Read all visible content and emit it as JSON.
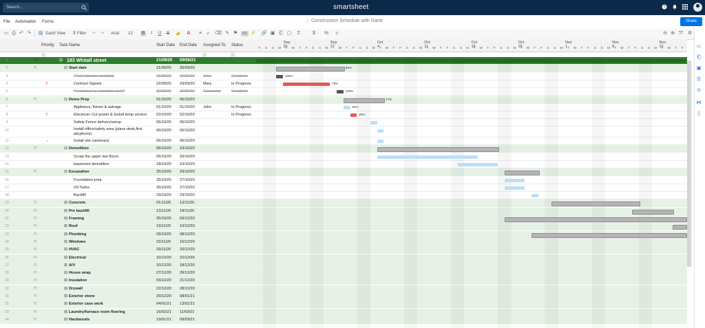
{
  "topbar": {
    "search_placeholder": "Search...",
    "brand": "smartsheet",
    "icons": [
      "help-icon",
      "bell-icon",
      "apps-grid-icon",
      "avatar"
    ]
  },
  "menu": {
    "items": [
      "File",
      "Automation",
      "Forms"
    ],
    "doc_title": "Construction Schedule with Gantt",
    "share_label": "Share"
  },
  "toolbar": {
    "view_label": "Gantt View",
    "filter_label": "Filter",
    "font_label": "Arial",
    "size_label": "12",
    "bold": "B",
    "italic": "I",
    "underline": "U",
    "strike": "S",
    "align": "≡",
    "sum": "Σ",
    "dollar": "$",
    "percent": "%",
    "decimal": ".0",
    "rs_badge": "RS"
  },
  "columns": {
    "priority": "Priority",
    "task": "Task Name",
    "start": "Start Date",
    "end": "End Date",
    "assigned": "Assigned To",
    "status": "Status"
  },
  "gantt": {
    "weeks": [
      "Sep 20",
      "Sep 27",
      "Oct 4",
      "Oct 11",
      "Oct 18",
      "Oct 25",
      "Nov 1",
      "Nov 8",
      "Nov 15"
    ],
    "day_letters": [
      "F",
      "S",
      "S",
      "M",
      "T",
      "W",
      "T",
      "F",
      "S",
      "S",
      "M",
      "T",
      "W",
      "T",
      "F",
      "S",
      "S",
      "M",
      "T",
      "W",
      "T",
      "F",
      "S",
      "S",
      "M",
      "T",
      "W",
      "T",
      "F",
      "S",
      "S",
      "M",
      "T",
      "W",
      "T",
      "F",
      "S",
      "S",
      "M",
      "T",
      "W",
      "T",
      "F",
      "S",
      "S",
      "M",
      "T",
      "W",
      "T",
      "F",
      "S",
      "S",
      "M",
      "T",
      "W",
      "T",
      "F",
      "S",
      "S",
      "M",
      "T",
      "W",
      "T",
      "F"
    ]
  },
  "rows": [
    {
      "num": "1",
      "name": "183 Whitall street",
      "start": "21/09/20",
      "end": "09/06/21",
      "assigned": "",
      "status": "",
      "level": 0,
      "type": "root"
    },
    {
      "num": "2",
      "name": "Start date",
      "start": "21/09/20",
      "end": "30/09/20",
      "assigned": "",
      "status": "",
      "level": 1,
      "type": "parent"
    },
    {
      "num": "3",
      "name": "Final estimate complete",
      "start": "21/09/20",
      "end": "21/09/20",
      "assigned": "John",
      "status": "Complete",
      "level": 2,
      "type": "done"
    },
    {
      "num": "4",
      "name": "Contract Signed",
      "start": "22/09/20",
      "end": "29/09/20",
      "assigned": "Mary",
      "status": "In Progress",
      "level": 2,
      "type": "task",
      "flag": "!"
    },
    {
      "num": "5",
      "name": "Permission to schedule work?",
      "start": "30/09/20",
      "end": "30/09/20",
      "assigned": "Contractor",
      "status": "Complete",
      "level": 2,
      "type": "done"
    },
    {
      "num": "6",
      "name": "Demo Prep",
      "start": "01/10/20",
      "end": "06/10/20",
      "assigned": "",
      "status": "",
      "level": 1,
      "type": "parent"
    },
    {
      "num": "7",
      "name": "Appliance, fixture & salvage",
      "start": "01/10/20",
      "end": "01/10/20",
      "assigned": "John",
      "status": "In Progress",
      "level": 2,
      "type": "task"
    },
    {
      "num": "8",
      "name": "Electrical- Cut power & Install temp service",
      "start": "02/10/20",
      "end": "02/10/20",
      "assigned": "",
      "status": "In Progress",
      "level": 2,
      "type": "task",
      "flag": "!"
    },
    {
      "num": "9",
      "name": "Safety Fence delivery/setup",
      "start": "05/10/20",
      "end": "05/10/20",
      "assigned": "",
      "status": "",
      "level": 2,
      "type": "task"
    },
    {
      "num": "10",
      "name": "Install office/safety area (plans desk,first aid,phone)",
      "start": "06/10/20",
      "end": "06/10/20",
      "assigned": "",
      "status": "",
      "level": 2,
      "type": "task",
      "tall": true
    },
    {
      "num": "11",
      "name": "Install site camera(s)",
      "start": "06/10/20",
      "end": "06/10/20",
      "assigned": "",
      "status": "",
      "level": 2,
      "type": "task",
      "flag": "↓"
    },
    {
      "num": "12",
      "name": "Demolition",
      "start": "06/10/20",
      "end": "23/10/20",
      "assigned": "",
      "status": "",
      "level": 1,
      "type": "parent"
    },
    {
      "num": "13",
      "name": "Scrap the upper two floors",
      "start": "06/10/20",
      "end": "20/10/20",
      "assigned": "",
      "status": "",
      "level": 2,
      "type": "task"
    },
    {
      "num": "14",
      "name": "basement demolition",
      "start": "18/10/20",
      "end": "23/10/20",
      "assigned": "",
      "status": "",
      "level": 2,
      "type": "task"
    },
    {
      "num": "15",
      "name": "Excavation",
      "start": "25/10/20",
      "end": "29/10/20",
      "assigned": "",
      "status": "",
      "level": 1,
      "type": "parent"
    },
    {
      "num": "16",
      "name": "Foundation prep",
      "start": "25/10/20",
      "end": "27/10/20",
      "assigned": "",
      "status": "",
      "level": 2,
      "type": "task"
    },
    {
      "num": "17",
      "name": "Oil Tanks",
      "start": "25/10/20",
      "end": "27/10/20",
      "assigned": "",
      "status": "",
      "level": 2,
      "type": "task"
    },
    {
      "num": "18",
      "name": "Backfill",
      "start": "29/10/20",
      "end": "29/10/20",
      "assigned": "",
      "status": "",
      "level": 2,
      "type": "task"
    },
    {
      "num": "19",
      "name": "Concrete",
      "start": "01/11/20",
      "end": "13/11/20",
      "assigned": "",
      "status": "",
      "level": 1,
      "type": "collapsed"
    },
    {
      "num": "20",
      "name": "Pre backfill",
      "start": "13/11/20",
      "end": "18/11/20",
      "assigned": "",
      "status": "",
      "level": 1,
      "type": "collapsed"
    },
    {
      "num": "21",
      "name": "Framing",
      "start": "25/10/20",
      "end": "09/12/20",
      "assigned": "",
      "status": "",
      "level": 1,
      "type": "collapsed"
    },
    {
      "num": "22",
      "name": "Roof",
      "start": "19/11/20",
      "end": "10/12/20",
      "assigned": "",
      "status": "",
      "level": 1,
      "type": "collapsed"
    },
    {
      "num": "23",
      "name": "Plumbing",
      "start": "29/10/20",
      "end": "08/12/20",
      "assigned": "",
      "status": "",
      "level": 1,
      "type": "collapsed"
    },
    {
      "num": "24",
      "name": "Windows",
      "start": "22/11/20",
      "end": "15/12/20",
      "assigned": "",
      "status": "",
      "level": 1,
      "type": "collapsed"
    },
    {
      "num": "25",
      "name": "HVAC",
      "start": "29/11/20",
      "end": "20/12/20",
      "assigned": "",
      "status": "",
      "level": 1,
      "type": "collapsed"
    },
    {
      "num": "26",
      "name": "Electrical",
      "start": "10/12/20",
      "end": "22/12/20",
      "assigned": "",
      "status": "",
      "level": 1,
      "type": "collapsed"
    },
    {
      "num": "27",
      "name": "A/V",
      "start": "10/12/20",
      "end": "18/12/20",
      "assigned": "",
      "status": "",
      "level": 1,
      "type": "collapsed"
    },
    {
      "num": "28",
      "name": "House wrap",
      "start": "27/12/20",
      "end": "29/12/20",
      "assigned": "",
      "status": "",
      "level": 1,
      "type": "collapsed"
    },
    {
      "num": "29",
      "name": "Insulation",
      "start": "03/12/20",
      "end": "21/12/20",
      "assigned": "",
      "status": "",
      "level": 1,
      "type": "collapsed"
    },
    {
      "num": "30",
      "name": "Drywall",
      "start": "22/12/20",
      "end": "28/12/20",
      "assigned": "",
      "status": "",
      "level": 1,
      "type": "collapsed"
    },
    {
      "num": "31",
      "name": "Exterior stone",
      "start": "29/12/20",
      "end": "08/01/21",
      "assigned": "",
      "status": "",
      "level": 1,
      "type": "collapsed"
    },
    {
      "num": "32",
      "name": "Exterior case work",
      "start": "04/01/21",
      "end": "13/01/21",
      "assigned": "",
      "status": "",
      "level": 1,
      "type": "collapsed"
    },
    {
      "num": "33",
      "name": "Laundry/furnace room flooring",
      "start": "16/02/21",
      "end": "11/03/21",
      "assigned": "",
      "status": "",
      "level": 1,
      "type": "collapsed"
    },
    {
      "num": "34",
      "name": "Hardwoods",
      "start": "19/01/21",
      "end": "09/03/21",
      "assigned": "",
      "status": "",
      "level": 1,
      "type": "collapsed"
    }
  ],
  "bars": [
    {
      "row": 0,
      "s": 0,
      "e": 64,
      "kind": "root"
    },
    {
      "row": 1,
      "s": 3,
      "e": 13,
      "kind": "summary",
      "pct": "84%"
    },
    {
      "row": 2,
      "s": 3,
      "e": 4,
      "kind": "done",
      "pct": "100%"
    },
    {
      "row": 3,
      "s": 4,
      "e": 11,
      "kind": "red",
      "pct": "78%"
    },
    {
      "row": 4,
      "s": 12,
      "e": 13,
      "kind": "done",
      "pct": "100%"
    },
    {
      "row": 5,
      "s": 13,
      "e": 19,
      "kind": "summary",
      "pct": "17%"
    },
    {
      "row": 6,
      "s": 13,
      "e": 14,
      "kind": "task",
      "pct": "60%"
    },
    {
      "row": 7,
      "s": 14,
      "e": 15,
      "kind": "red",
      "pct": "25%"
    },
    {
      "row": 8,
      "s": 17,
      "e": 18,
      "kind": "task"
    },
    {
      "row": 9,
      "s": 18,
      "e": 19,
      "kind": "task"
    },
    {
      "row": 10,
      "s": 18,
      "e": 19,
      "kind": "task"
    },
    {
      "row": 11,
      "s": 18,
      "e": 36,
      "kind": "summary"
    },
    {
      "row": 12,
      "s": 18,
      "e": 33,
      "kind": "task"
    },
    {
      "row": 13,
      "s": 30,
      "e": 36,
      "kind": "task"
    },
    {
      "row": 14,
      "s": 37,
      "e": 42,
      "kind": "summary"
    },
    {
      "row": 15,
      "s": 37,
      "e": 40,
      "kind": "task"
    },
    {
      "row": 16,
      "s": 37,
      "e": 40,
      "kind": "task"
    },
    {
      "row": 17,
      "s": 41,
      "e": 42,
      "kind": "task"
    },
    {
      "row": 18,
      "s": 44,
      "e": 57,
      "kind": "summary"
    },
    {
      "row": 19,
      "s": 56,
      "e": 62,
      "kind": "summary"
    },
    {
      "row": 20,
      "s": 37,
      "e": 64,
      "kind": "summary"
    },
    {
      "row": 21,
      "s": 62,
      "e": 64,
      "kind": "summary"
    },
    {
      "row": 22,
      "s": 41,
      "e": 64,
      "kind": "summary"
    }
  ]
}
